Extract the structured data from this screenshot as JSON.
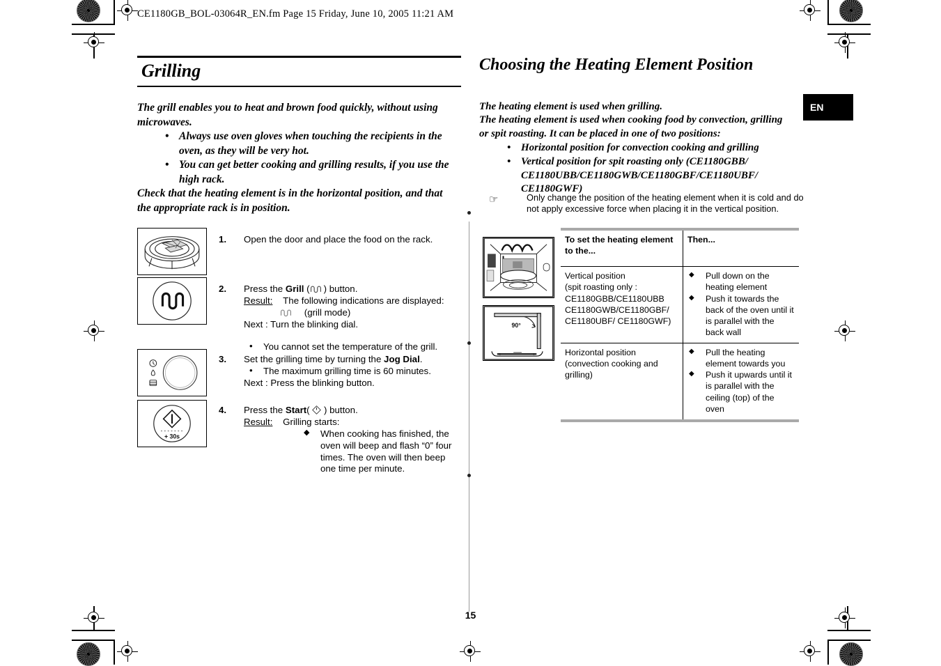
{
  "header": {
    "file_line": "CE1180GB_BOL-03064R_EN.fm  Page 15  Friday, June 10, 2005  11:21 AM"
  },
  "language_tab": {
    "label": "EN"
  },
  "page_number": "15",
  "left_column": {
    "title": "Grilling",
    "intro_line1": "The grill enables you to heat and brown food quickly, without using",
    "intro_line2": "microwaves.",
    "intro_bullets": [
      "Always use oven gloves when touching the recipients in the oven, as they will be very hot.",
      "You can get better cooking and grilling results, if you use the high rack."
    ],
    "intro_closing_line1": "Check that the heating element is in the horizontal position, and that",
    "intro_closing_line2": "the appropriate rack is in position.",
    "steps": [
      {
        "number": "1.",
        "text": "Open the door and place the food on the rack.",
        "image_name": "oven-rack-illustration"
      },
      {
        "number": "2.",
        "line1_pre": "Press the ",
        "line1_bold": "Grill",
        "line1_post": " (     ) button.",
        "result_label": "Result:",
        "result_text": "The following indications are displayed:",
        "mode_label": "(grill mode)",
        "next_text": "Next : Turn the blinking dial.",
        "bullet": "You cannot set the temperature of the grill.",
        "image_name": "grill-button-illustration"
      },
      {
        "number": "3.",
        "line1_pre": "Set the grilling time by turning the ",
        "line1_bold": "Jog Dial",
        "line1_post": ".",
        "bullet": "The maximum grilling time is 60 minutes.",
        "next_text": "Next : Press the blinking button.",
        "image_name": "jog-dial-illustration"
      },
      {
        "number": "4.",
        "line1_pre": "Press the ",
        "line1_bold": "Start",
        "line1_post": "(      ) button.",
        "result_label": "Result:",
        "result_text": "Grilling starts:",
        "diamond_text": "When cooking has finished, the oven will beep and flash “0” four times. The oven will then beep one time per minute.",
        "image_name": "start-button-illustration"
      }
    ]
  },
  "right_column": {
    "title": "Choosing the Heating Element Position",
    "intro_line1": "The heating element is used when grilling.",
    "intro_line2": "The heating element is used when cooking food by convection, grilling",
    "intro_line3": "or spit roasting. It can be placed in one of two positions:",
    "intro_bullets": [
      "Horizontal position for convection cooking and grilling",
      "Vertical position for spit roasting only (CE1180GBB/ CE1180UBB/CE1180GWB/CE1180GBF/CE1180UBF/ CE1180GWF)"
    ],
    "note": "Only change the position of the heating element when it is cold and do not apply excessive force when placing it in the vertical position.",
    "table": {
      "headers": [
        "To set the heating element to the...",
        "Then..."
      ],
      "rows": [
        {
          "setting": "Vertical position (spit roasting only : CE1180GBB/CE1180UBB CE1180GWB/CE1180GBF/ CE1180UBF/ CE1180GWF)",
          "setting_lines": [
            "Vertical position",
            "(spit roasting only :",
            "CE1180GBB/CE1180UBB",
            "CE1180GWB/CE1180GBF/",
            "CE1180UBF/ CE1180GWF)"
          ],
          "actions": [
            "Pull down on the heating element",
            "Push it towards the back of the oven until it is parallel with the back wall"
          ]
        },
        {
          "setting": "Horizontal position (convection cooking and grilling)",
          "setting_lines": [
            "Horizontal position",
            "(convection cooking and",
            "grilling)"
          ],
          "actions": [
            "Pull the heating element towards you",
            "Push it upwards until it is parallel with the ceiling (top) of the oven"
          ]
        }
      ]
    },
    "images": [
      {
        "name": "oven-interior-illustration"
      },
      {
        "name": "heating-element-angle-illustration",
        "angle_label": "90°"
      }
    ]
  }
}
